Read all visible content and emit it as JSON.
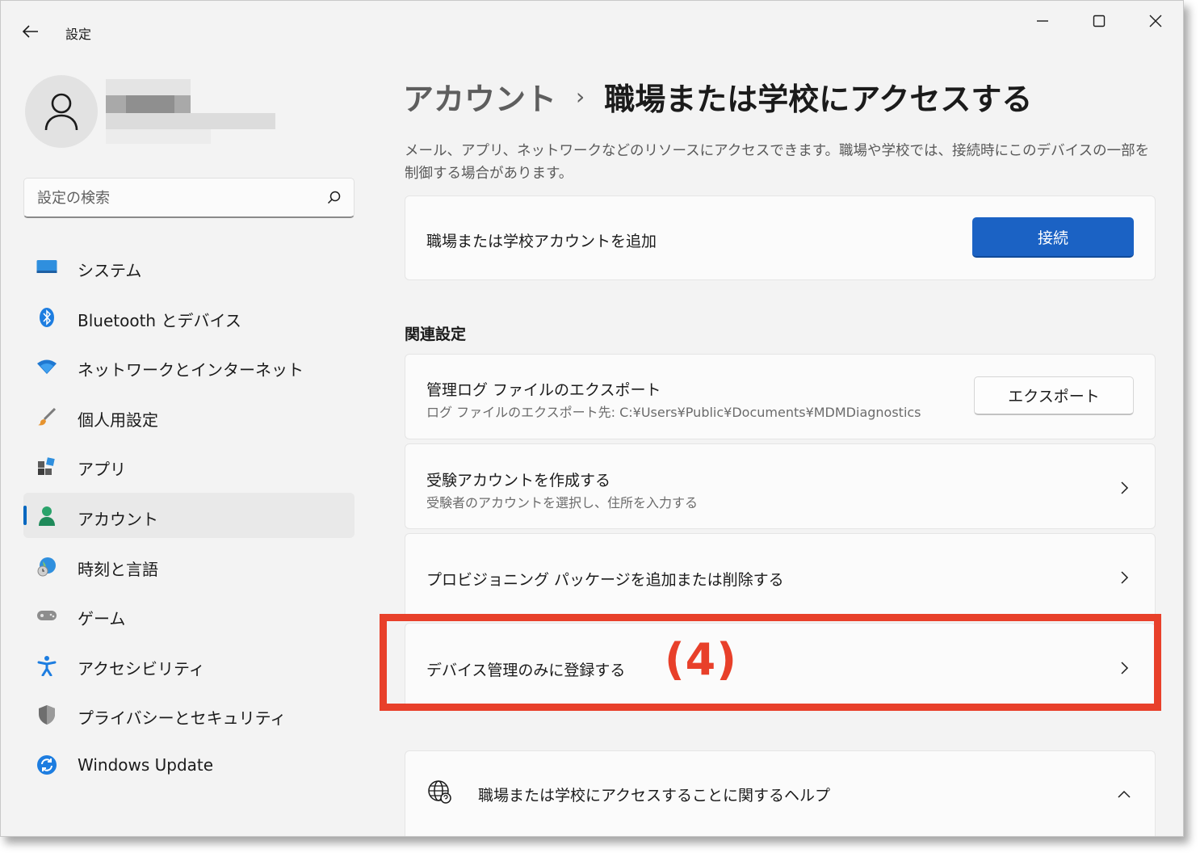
{
  "app": {
    "title": "設定"
  },
  "window_controls": {
    "minimize_icon": "minimize-icon",
    "maximize_icon": "maximize-icon",
    "close_icon": "close-icon"
  },
  "search": {
    "placeholder": "設定の検索"
  },
  "sidebar": {
    "items": [
      {
        "label": "システム",
        "icon": "system-icon"
      },
      {
        "label": "Bluetooth とデバイス",
        "icon": "bluetooth-icon"
      },
      {
        "label": "ネットワークとインターネット",
        "icon": "wifi-icon"
      },
      {
        "label": "個人用設定",
        "icon": "brush-icon"
      },
      {
        "label": "アプリ",
        "icon": "apps-icon"
      },
      {
        "label": "アカウント",
        "icon": "accounts-icon",
        "selected": true
      },
      {
        "label": "時刻と言語",
        "icon": "time-language-icon"
      },
      {
        "label": "ゲーム",
        "icon": "gamepad-icon"
      },
      {
        "label": "アクセシビリティ",
        "icon": "accessibility-icon"
      },
      {
        "label": "プライバシーとセキュリティ",
        "icon": "shield-icon"
      },
      {
        "label": "Windows Update",
        "icon": "update-icon"
      }
    ]
  },
  "header": {
    "parent": "アカウント",
    "separator": "›",
    "current": "職場または学校にアクセスする",
    "description": "メール、アプリ、ネットワークなどのリソースにアクセスできます。職場や学校では、接続時にこのデバイスの一部を制御する場合があります。"
  },
  "add_account": {
    "title": "職場または学校アカウントを追加",
    "button": "接続"
  },
  "related": {
    "section_title": "関連設定",
    "export": {
      "title": "管理ログ ファイルのエクスポート",
      "subtitle": "ログ ファイルのエクスポート先: C:¥Users¥Public¥Documents¥MDMDiagnostics",
      "button": "エクスポート"
    },
    "exam": {
      "title": "受験アカウントを作成する",
      "subtitle": "受験者のアカウントを選択し、住所を入力する"
    },
    "provisioning": {
      "title": "プロビジョニング パッケージを追加または削除する"
    },
    "enroll": {
      "title": "デバイス管理のみに登録する"
    }
  },
  "help": {
    "title": "職場または学校にアクセスすることに関するヘルプ"
  },
  "annotation": {
    "label": "(4)",
    "color": "#e8402a"
  },
  "colors": {
    "accent": "#1b62c4",
    "selection_indicator": "#0067c0",
    "highlight": "#e8402a"
  }
}
